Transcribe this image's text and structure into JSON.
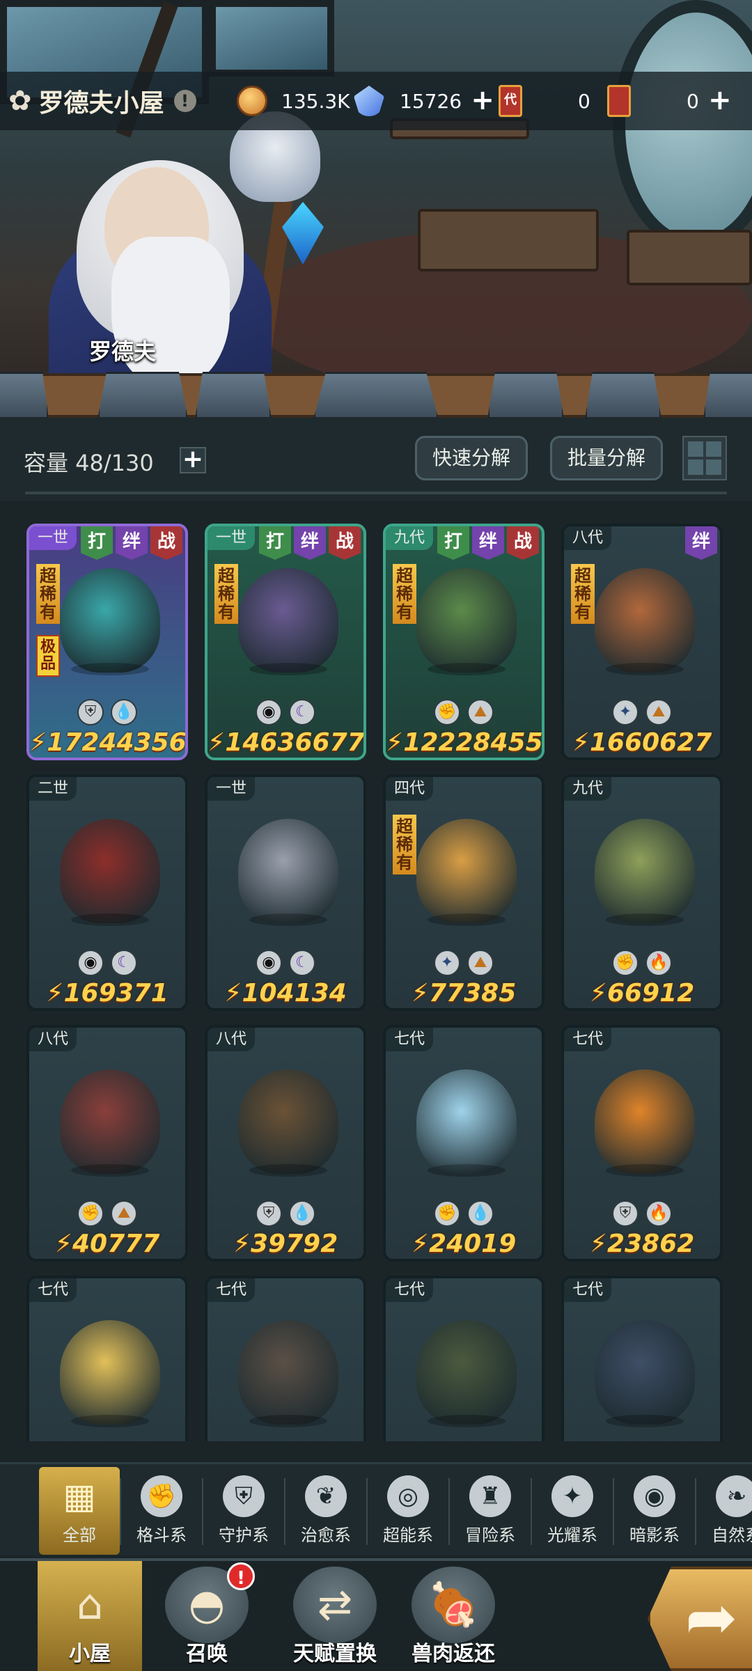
{
  "header": {
    "title": "罗德夫小屋",
    "info_icon": "!",
    "npc_name": "罗德夫"
  },
  "resources": {
    "coins": "135.3K",
    "gems": "15726",
    "ticket1_glyph": "代",
    "ticket1": "0",
    "ticket2": "0"
  },
  "capacity": {
    "label": "容量 48/130"
  },
  "actions": {
    "quick_decompose": "快速分解",
    "batch_decompose": "批量分解"
  },
  "cards": [
    {
      "gen": "一世",
      "tags": [
        "打",
        "绊",
        "战"
      ],
      "rare": "超稀有",
      "extra": "极品",
      "elements": [
        "guard",
        "water"
      ],
      "power": "17244356",
      "style": "purple",
      "color": "#3aa7a8"
    },
    {
      "gen": "一世",
      "tags": [
        "打",
        "绊",
        "战"
      ],
      "rare": "超稀有",
      "elements": [
        "dark",
        "dusk"
      ],
      "power": "14636677",
      "style": "green",
      "color": "#6a5b92"
    },
    {
      "gen": "九代",
      "tags": [
        "打",
        "绊",
        "战"
      ],
      "rare": "超稀有",
      "elements": [
        "fight",
        "earth"
      ],
      "power": "12228455",
      "style": "green",
      "color": "#5c8a4a"
    },
    {
      "gen": "八代",
      "tags": [
        "绊"
      ],
      "rare": "超稀有",
      "elements": [
        "light",
        "earth"
      ],
      "power": "1660627",
      "style": "plain",
      "color": "#b2683c"
    },
    {
      "gen": "二世",
      "tags": [],
      "elements": [
        "dark",
        "dusk"
      ],
      "power": "169371",
      "style": "plain",
      "color": "#8d2e2a"
    },
    {
      "gen": "一世",
      "tags": [],
      "elements": [
        "dark",
        "dusk"
      ],
      "power": "104134",
      "style": "plain",
      "color": "#9aa0ad"
    },
    {
      "gen": "四代",
      "tags": [],
      "rare": "超稀有",
      "elements": [
        "light",
        "earth"
      ],
      "power": "77385",
      "style": "plain",
      "color": "#d99e45"
    },
    {
      "gen": "九代",
      "tags": [],
      "elements": [
        "fight",
        "fire"
      ],
      "power": "66912",
      "style": "plain",
      "color": "#8ea05a"
    },
    {
      "gen": "八代",
      "tags": [],
      "elements": [
        "fight",
        "earth"
      ],
      "power": "40777",
      "style": "plain",
      "color": "#8a3f3a"
    },
    {
      "gen": "八代",
      "tags": [],
      "elements": [
        "guard",
        "water"
      ],
      "power": "39792",
      "style": "plain",
      "color": "#6b5236"
    },
    {
      "gen": "七代",
      "tags": [],
      "elements": [
        "fight",
        "water"
      ],
      "power": "24019",
      "style": "plain",
      "color": "#9fd3ea"
    },
    {
      "gen": "七代",
      "tags": [],
      "elements": [
        "guard",
        "fire"
      ],
      "power": "23862",
      "style": "plain",
      "color": "#e0842a"
    },
    {
      "gen": "七代",
      "tags": [],
      "elements": [],
      "power": "",
      "style": "plain",
      "color": "#e2c05a"
    },
    {
      "gen": "七代",
      "tags": [],
      "elements": [],
      "power": "",
      "style": "plain",
      "color": "#5b5046"
    },
    {
      "gen": "七代",
      "tags": [],
      "elements": [],
      "power": "",
      "style": "plain",
      "color": "#4b5a3e"
    },
    {
      "gen": "七代",
      "tags": [],
      "elements": [],
      "power": "",
      "style": "plain",
      "color": "#3f4e66"
    }
  ],
  "categories": [
    {
      "label": "全部",
      "icon": "grid"
    },
    {
      "label": "格斗系",
      "icon": "fist"
    },
    {
      "label": "守护系",
      "icon": "shield"
    },
    {
      "label": "治愈系",
      "icon": "sprout"
    },
    {
      "label": "超能系",
      "icon": "alien"
    },
    {
      "label": "冒险系",
      "icon": "lantern"
    },
    {
      "label": "光耀系",
      "icon": "star"
    },
    {
      "label": "暗影系",
      "icon": "eye"
    },
    {
      "label": "自然系",
      "icon": "leaf"
    }
  ],
  "nav": [
    {
      "label": "小屋",
      "icon": "house"
    },
    {
      "label": "召唤",
      "icon": "egg"
    },
    {
      "label": "天赋置换",
      "icon": "swap"
    },
    {
      "label": "兽肉返还",
      "icon": "meat"
    }
  ],
  "nav_badge": "!",
  "colors": {
    "power_text": "#ffd24d",
    "active_tab": "#d6b04b",
    "badge": "#e02a2a"
  }
}
